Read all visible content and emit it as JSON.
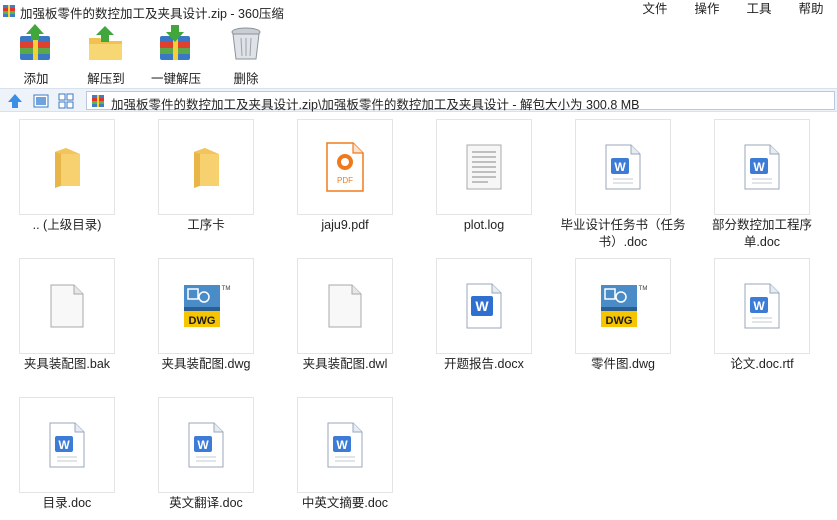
{
  "window": {
    "title": "加强板零件的数控加工及夹具设计.zip - 360压缩"
  },
  "menu": [
    "文件",
    "操作",
    "工具",
    "帮助"
  ],
  "toolbar": {
    "add": "添加",
    "extract_to": "解压到",
    "one_click_extract": "一键解压",
    "delete": "删除"
  },
  "address": {
    "path": "加强板零件的数控加工及夹具设计.zip\\加强板零件的数控加工及夹具设计 - 解包大小为 300.8 MB"
  },
  "files": [
    {
      "name": ".. (上级目录)",
      "icon": "folder-icon"
    },
    {
      "name": "工序卡",
      "icon": "folder-icon"
    },
    {
      "name": "jaju9.pdf",
      "icon": "pdf-icon"
    },
    {
      "name": "plot.log",
      "icon": "text-file-icon"
    },
    {
      "name": "毕业设计任务书（任务书）.doc",
      "icon": "word-doc-icon"
    },
    {
      "name": "部分数控加工程序单.doc",
      "icon": "word-doc-icon"
    },
    {
      "name": "夹具装配图.bak",
      "icon": "blank-file-icon"
    },
    {
      "name": "夹具装配图.dwg",
      "icon": "dwg-icon"
    },
    {
      "name": "夹具装配图.dwl",
      "icon": "blank-file-icon"
    },
    {
      "name": "开题报告.docx",
      "icon": "word-docx-icon"
    },
    {
      "name": "零件图.dwg",
      "icon": "dwg-icon"
    },
    {
      "name": "论文.doc.rtf",
      "icon": "word-doc-icon"
    },
    {
      "name": "目录.doc",
      "icon": "word-doc-icon"
    },
    {
      "name": "英文翻译.doc",
      "icon": "word-doc-icon"
    },
    {
      "name": "中英文摘要.doc",
      "icon": "word-doc-icon"
    }
  ],
  "icon_labels": {
    "pdf": "PDF",
    "dwg": "DWG",
    "tm": "TM",
    "word": "W"
  },
  "colors": {
    "folder": "#f3c867",
    "pdf_accent": "#f07a1b",
    "word_blue": "#3c7bd6",
    "dwg_yellow": "#f6c400"
  }
}
